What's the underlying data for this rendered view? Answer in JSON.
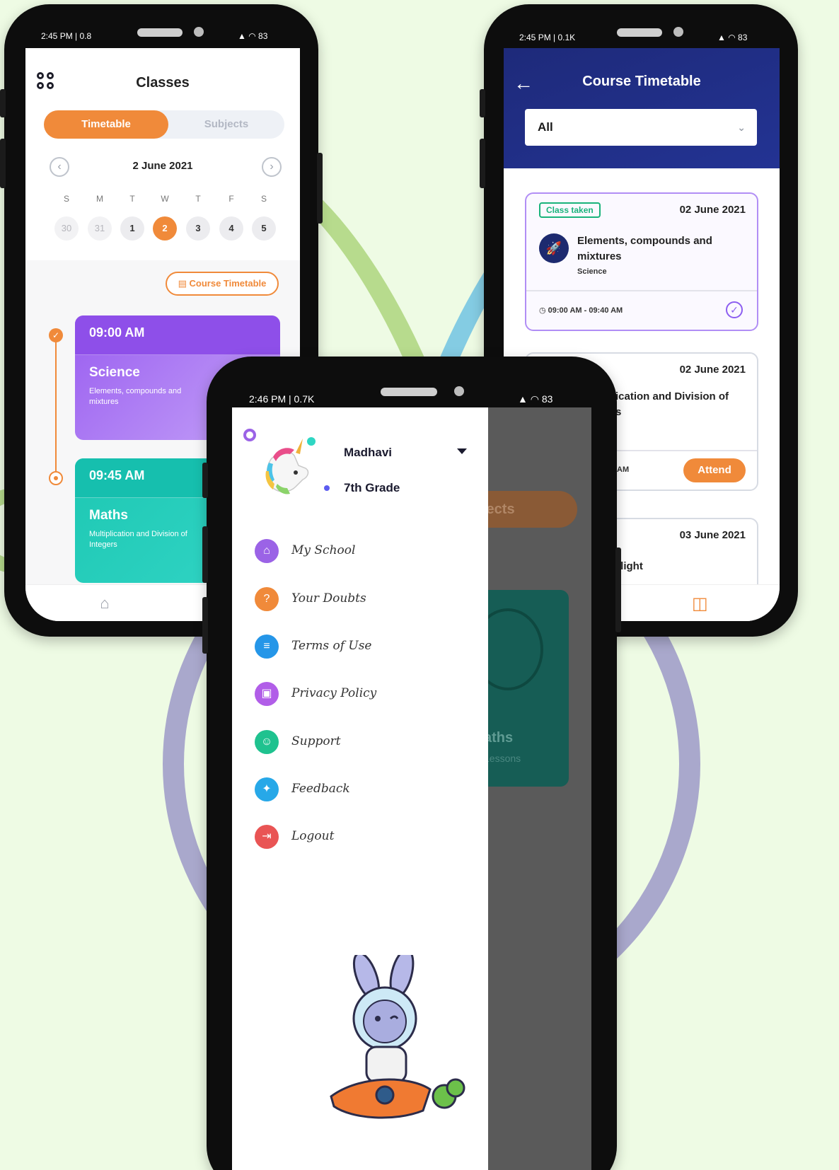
{
  "colors": {
    "accent_orange": "#f08a3a",
    "purple_card": "#9a5ef0",
    "teal_card": "#1ec8b3",
    "navy_header": "#1e2a7a",
    "background": "#eefbe4"
  },
  "phone_classes": {
    "status_time": "2:45 PM | 0.8",
    "status_battery": "83",
    "title": "Classes",
    "tabs": {
      "active": "Timetable",
      "inactive": "Subjects"
    },
    "calendar": {
      "date": "2 June 2021",
      "weekdays": [
        "S",
        "M",
        "T",
        "W",
        "T",
        "F",
        "S"
      ],
      "days": [
        "30",
        "31",
        "1",
        "2",
        "3",
        "4",
        "5"
      ],
      "selected_day": "2"
    },
    "course_timetable_button": "Course Timetable",
    "cards": [
      {
        "time": "09:00 AM",
        "subject": "Science",
        "topic": "Elements, compounds and mixtures"
      },
      {
        "time": "09:45 AM",
        "subject": "Maths",
        "topic": "Multiplication and Division of Integers"
      }
    ],
    "nav_icon": "home-icon"
  },
  "phone_timetable": {
    "status_time": "2:45 PM | 0.1K",
    "status_battery": "83",
    "title": "Course Timetable",
    "filter": {
      "value": "All"
    },
    "entries": [
      {
        "badge": "Class taken",
        "date": "02 June 2021",
        "topic": "Elements, compounds and mixtures",
        "subject": "Science",
        "time": "09:00 AM - 09:40 AM"
      },
      {
        "badge": "lass",
        "date": "02 June 2021",
        "topic": "ication and Division of",
        "topic_line2": "s",
        "time": "AM",
        "action": "Attend"
      },
      {
        "date": "03 June 2021",
        "topic": "f light"
      }
    ],
    "nav_icon": "book-icon"
  },
  "phone_drawer": {
    "status_time": "2:46 PM | 0.7K",
    "status_battery": "83",
    "user": {
      "name": "Madhavi",
      "grade": "7th Grade"
    },
    "menu": [
      {
        "label": "My School",
        "icon": "school-icon",
        "color": "#9b63e6"
      },
      {
        "label": "Your Doubts",
        "icon": "question-icon",
        "color": "#f08a3a"
      },
      {
        "label": "Terms of Use",
        "icon": "document-icon",
        "color": "#2596e8"
      },
      {
        "label": "Privacy Policy",
        "icon": "privacy-icon",
        "color": "#b15ee8"
      },
      {
        "label": "Support",
        "icon": "support-icon",
        "color": "#1fc28f"
      },
      {
        "label": "Feedback",
        "icon": "feedback-icon",
        "color": "#27a8e8"
      },
      {
        "label": "Logout",
        "icon": "logout-icon",
        "color": "#e95454"
      }
    ],
    "background": {
      "pill": "jects",
      "card_title": "aths",
      "card_sub": "Lessons"
    }
  }
}
